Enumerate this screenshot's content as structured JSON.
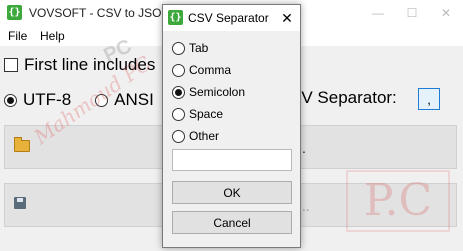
{
  "main_window": {
    "title": "VOVSOFT - CSV to JSON C",
    "title_buttons": [
      "—",
      "☐",
      "✕"
    ],
    "menu": [
      "File",
      "Help"
    ],
    "first_line_label": "First line includes",
    "encoding_options": [
      {
        "label": "UTF-8",
        "selected": true
      },
      {
        "label": "ANSI",
        "selected": false
      }
    ],
    "separator_label": "SV Separator:",
    "separator_button": ",",
    "open_panel_suffix": ".",
    "save_panel_suffix": "..",
    "watermark_text": "Mahmoud PC",
    "watermark_pc": "PC",
    "watermark_logo": "P.C"
  },
  "dialog": {
    "icon_glyph": "{}",
    "title": "CSV Separator",
    "close_glyph": "✕",
    "options": [
      {
        "label": "Tab",
        "selected": false
      },
      {
        "label": "Comma",
        "selected": false
      },
      {
        "label": "Semicolon",
        "selected": true
      },
      {
        "label": "Space",
        "selected": false
      },
      {
        "label": "Other",
        "selected": false
      }
    ],
    "other_value": "",
    "ok_label": "OK",
    "cancel_label": "Cancel"
  },
  "icons": {
    "app": "json-braces-icon",
    "open": "folder-icon",
    "save": "floppy-disk-icon"
  },
  "colors": {
    "app_icon": "#3da93d",
    "focus_border": "#1c7cd6"
  }
}
